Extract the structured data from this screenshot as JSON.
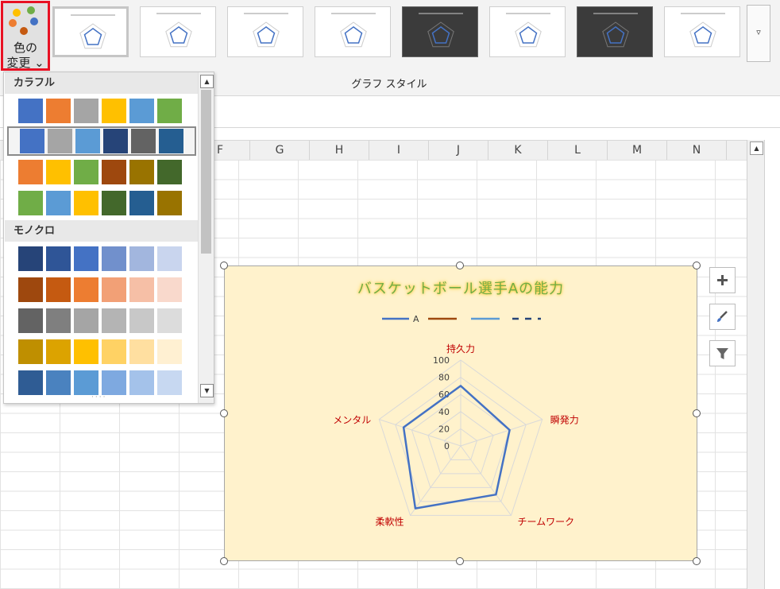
{
  "ribbon": {
    "change_colors_label_line1": "色の",
    "change_colors_label_line2": "変更 ⌄",
    "group_label": "グラフ スタイル",
    "more_button": "▿"
  },
  "columns": [
    "F",
    "G",
    "H",
    "I",
    "J",
    "K",
    "L",
    "M",
    "N"
  ],
  "dropdown": {
    "groups": [
      {
        "name": "カラフル",
        "palettes": [
          [
            "#4472c4",
            "#ed7d31",
            "#a5a5a5",
            "#ffc000",
            "#5b9bd5",
            "#70ad47"
          ],
          [
            "#4472c4",
            "#a5a5a5",
            "#5b9bd5",
            "#264478",
            "#636363",
            "#255e91"
          ],
          [
            "#ed7d31",
            "#ffc000",
            "#70ad47",
            "#9e480e",
            "#997300",
            "#43682b"
          ],
          [
            "#70ad47",
            "#5b9bd5",
            "#ffc000",
            "#43682b",
            "#255e91",
            "#997300"
          ]
        ]
      },
      {
        "name": "モノクロ",
        "palettes": [
          [
            "#264478",
            "#2f5597",
            "#4472c4",
            "#7190cc",
            "#a2b6de",
            "#c9d5ee"
          ],
          [
            "#9e480e",
            "#c55a11",
            "#ed7d31",
            "#f2a076",
            "#f6bfa6",
            "#f9d9cc"
          ],
          [
            "#636363",
            "#7f7f7f",
            "#a5a5a5",
            "#b4b4b4",
            "#c8c8c8",
            "#dcdcdc"
          ],
          [
            "#bf8f00",
            "#dca300",
            "#ffc000",
            "#ffd264",
            "#ffdfa0",
            "#fff0d2"
          ],
          [
            "#2f5c94",
            "#4a82bf",
            "#5b9bd5",
            "#7ea9e0",
            "#a4c2ea",
            "#c7d8f1"
          ]
        ]
      }
    ]
  },
  "chart_data": {
    "type": "radar",
    "title": "バスケットボール選手Aの能力",
    "categories": [
      "持久力",
      "瞬発力",
      "チームワーク",
      "柔軟性",
      "メンタル"
    ],
    "series": [
      {
        "name": "A",
        "color": "#4472c4",
        "values": [
          70,
          60,
          70,
          90,
          70
        ]
      }
    ],
    "legend_extra_colors": [
      "#9e480e",
      "#5b9bd5",
      "#264478"
    ],
    "ticks": [
      "100",
      "80",
      "60",
      "40",
      "20",
      "0"
    ],
    "rmin": 0,
    "rmax": 100,
    "legend": "top",
    "category_label_color": "#c00000",
    "background": "#fff2cc"
  }
}
